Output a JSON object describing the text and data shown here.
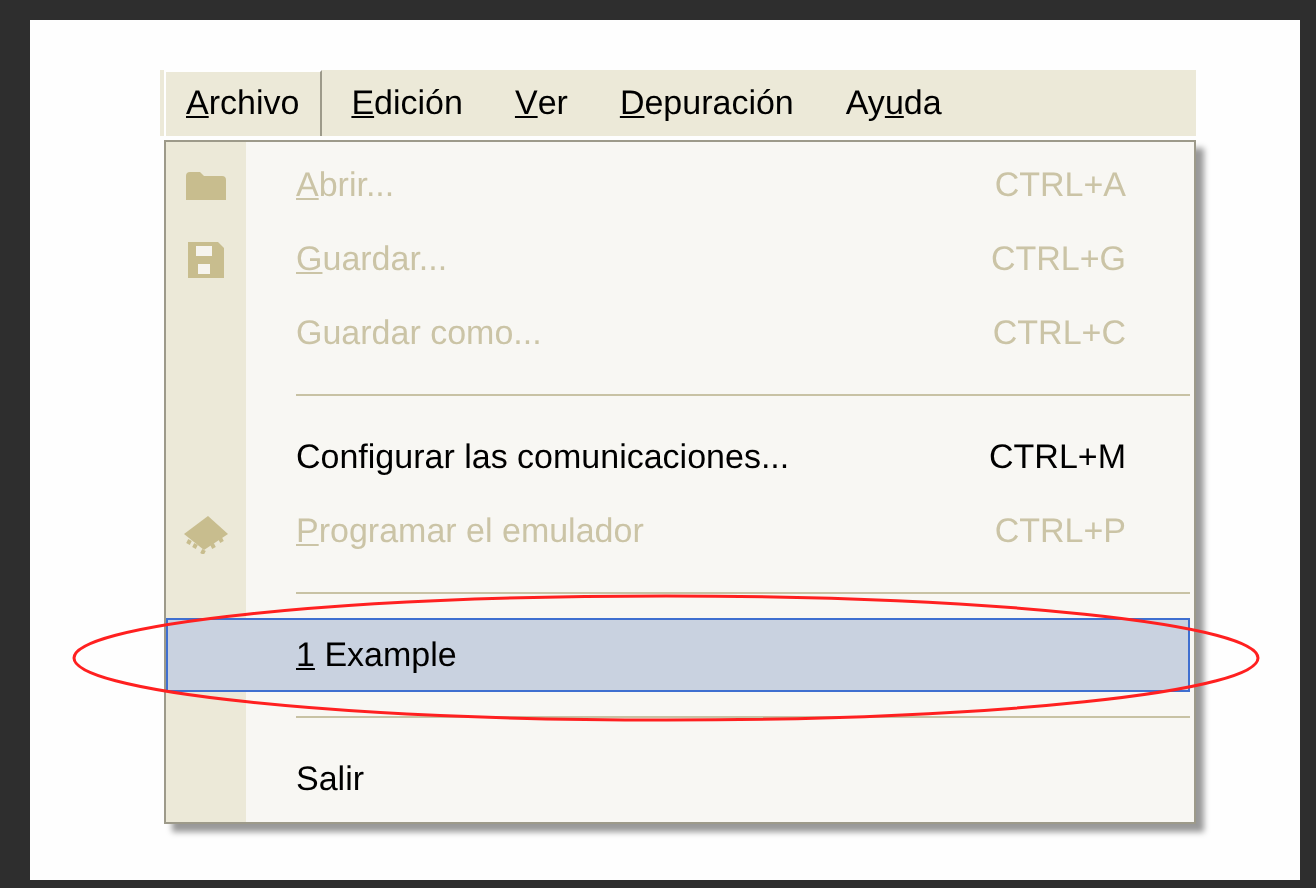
{
  "menubar": [
    {
      "label": [
        {
          "text": "A",
          "underlined": true
        },
        {
          "text": "rchivo",
          "underlined": false
        }
      ],
      "selected": true
    },
    {
      "label": [
        {
          "text": "E",
          "underlined": true
        },
        {
          "text": "dición",
          "underlined": false
        }
      ],
      "selected": false
    },
    {
      "label": [
        {
          "text": "V",
          "underlined": true
        },
        {
          "text": "er",
          "underlined": false
        }
      ],
      "selected": false
    },
    {
      "label": [
        {
          "text": "D",
          "underlined": true
        },
        {
          "text": "epuración",
          "underlined": false
        }
      ],
      "selected": false
    },
    {
      "label": [
        {
          "text": "Ay",
          "underlined": false
        },
        {
          "text": "u",
          "underlined": true
        },
        {
          "text": "da",
          "underlined": false
        }
      ],
      "selected": false
    }
  ],
  "menu": [
    {
      "kind": "command",
      "label": [
        {
          "text": "A",
          "underlined": true
        },
        {
          "text": "brir...",
          "underlined": false
        }
      ],
      "shortcut": "CTRL+A",
      "disabled": true,
      "selected": false
    },
    {
      "kind": "command",
      "label": [
        {
          "text": "G",
          "underlined": true
        },
        {
          "text": "uardar...",
          "underlined": false
        }
      ],
      "shortcut": "CTRL+G",
      "disabled": true,
      "selected": false
    },
    {
      "kind": "command",
      "label": [
        {
          "text": "Guardar como...",
          "underlined": false
        }
      ],
      "shortcut": "CTRL+C",
      "disabled": true,
      "selected": false
    },
    {
      "kind": "separator"
    },
    {
      "kind": "command",
      "label": [
        {
          "text": "Configurar las comunicaciones...",
          "underlined": false
        }
      ],
      "shortcut": "CTRL+M",
      "disabled": false,
      "selected": false
    },
    {
      "kind": "command",
      "label": [
        {
          "text": "P",
          "underlined": true
        },
        {
          "text": "rogramar el emulador",
          "underlined": false
        }
      ],
      "shortcut": "CTRL+P",
      "disabled": true,
      "selected": false
    },
    {
      "kind": "separator"
    },
    {
      "kind": "command",
      "label": [
        {
          "text": "1",
          "underlined": true
        },
        {
          "text": " Example",
          "underlined": false
        }
      ],
      "disabled": false,
      "selected": true
    },
    {
      "kind": "separator"
    },
    {
      "kind": "command",
      "label": [
        {
          "text": "Salir",
          "underlined": false
        }
      ],
      "disabled": false,
      "selected": false
    }
  ],
  "annotation": {
    "kind": "ellipse"
  }
}
